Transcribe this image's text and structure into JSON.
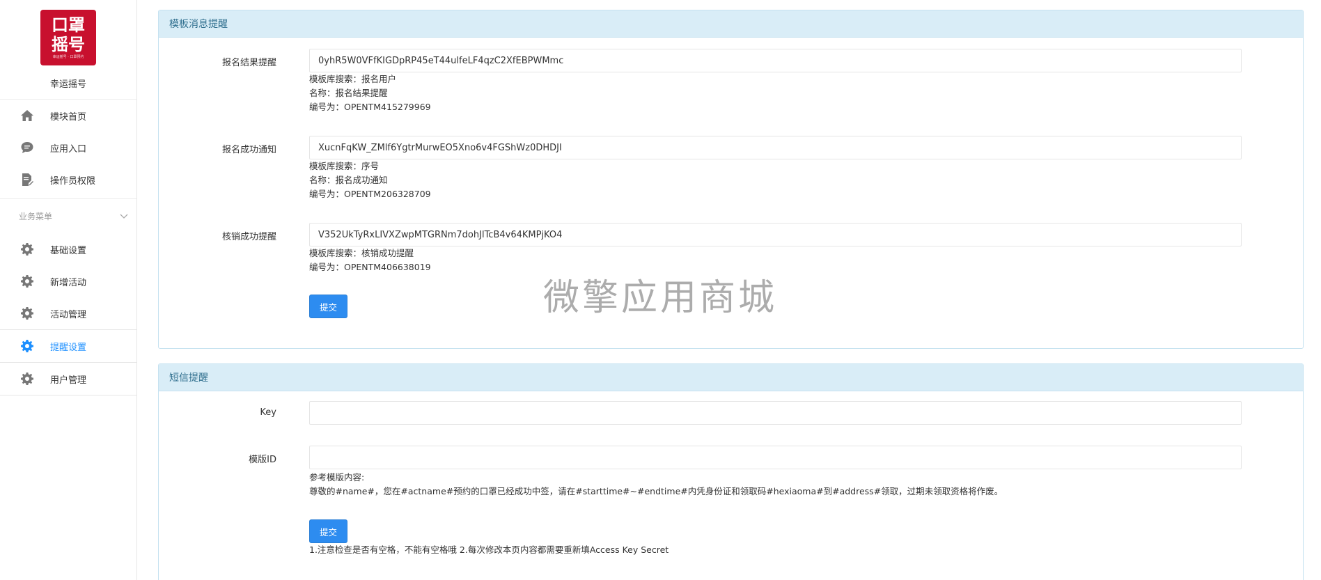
{
  "app": {
    "logo_lines": [
      "口罩",
      "摇号"
    ],
    "logo_sub": "幸运摇号 · 口罩预约",
    "name": "幸运摇号"
  },
  "sidebar": {
    "top_items": [
      {
        "label": "模块首页",
        "icon": "home-icon"
      },
      {
        "label": "应用入口",
        "icon": "chat-icon"
      },
      {
        "label": "操作员权限",
        "icon": "edit-doc-icon"
      }
    ],
    "section_title": "业务菜单",
    "items": [
      {
        "label": "基础设置",
        "icon": "gear-icon",
        "active": false
      },
      {
        "label": "新增活动",
        "icon": "gear-icon",
        "active": false
      },
      {
        "label": "活动管理",
        "icon": "gear-icon",
        "active": false
      },
      {
        "label": "提醒设置",
        "icon": "gear-icon",
        "active": true
      },
      {
        "label": "用户管理",
        "icon": "gear-icon",
        "active": false
      }
    ]
  },
  "template_panel": {
    "title": "模板消息提醒",
    "fields": [
      {
        "label": "报名结果提醒",
        "value": "0yhR5W0VFfKIGDpRP45eT44ulfeLF4qzC2XfEBPWMmc",
        "help": [
          "模板库搜索：报名用户",
          "名称：报名结果提醒",
          "编号为：OPENTM415279969"
        ]
      },
      {
        "label": "报名成功通知",
        "value": "XucnFqKW_ZMlf6YgtrMurwEO5Xno6v4FGShWz0DHDJI",
        "help": [
          "模板库搜索：序号",
          "名称：报名成功通知",
          "编号为：OPENTM206328709"
        ]
      },
      {
        "label": "核销成功提醒",
        "value": "V352UkTyRxLIVXZwpMTGRNm7dohJlTcB4v64KMPjKO4",
        "help": [
          "模板库搜索：核销成功提醒",
          "编号为：OPENTM406638019"
        ]
      }
    ],
    "submit_label": "提交"
  },
  "sms_panel": {
    "title": "短信提醒",
    "key_label": "Key",
    "key_value": "",
    "template_label": "模版ID",
    "template_value": "",
    "ref_title": "参考模版内容:",
    "ref_content": "尊敬的#name#，您在#actname#预约的口罩已经成功中签，请在#starttime#~#endtime#内凭身份证和领取码#hexiaoma#到#address#领取，过期未领取资格将作废。",
    "submit_label": "提交",
    "note": "1.注意检查是否有空格，不能有空格哦 2.每次修改本页内容都需要重新填Access Key Secret"
  },
  "watermark": "微擎应用商城",
  "colors": {
    "accent": "#2d8cf0",
    "active_nav": "#1e90ff",
    "panel_head": "#d9edf7",
    "panel_title": "#31708f",
    "logo_bg": "#c8102e"
  }
}
